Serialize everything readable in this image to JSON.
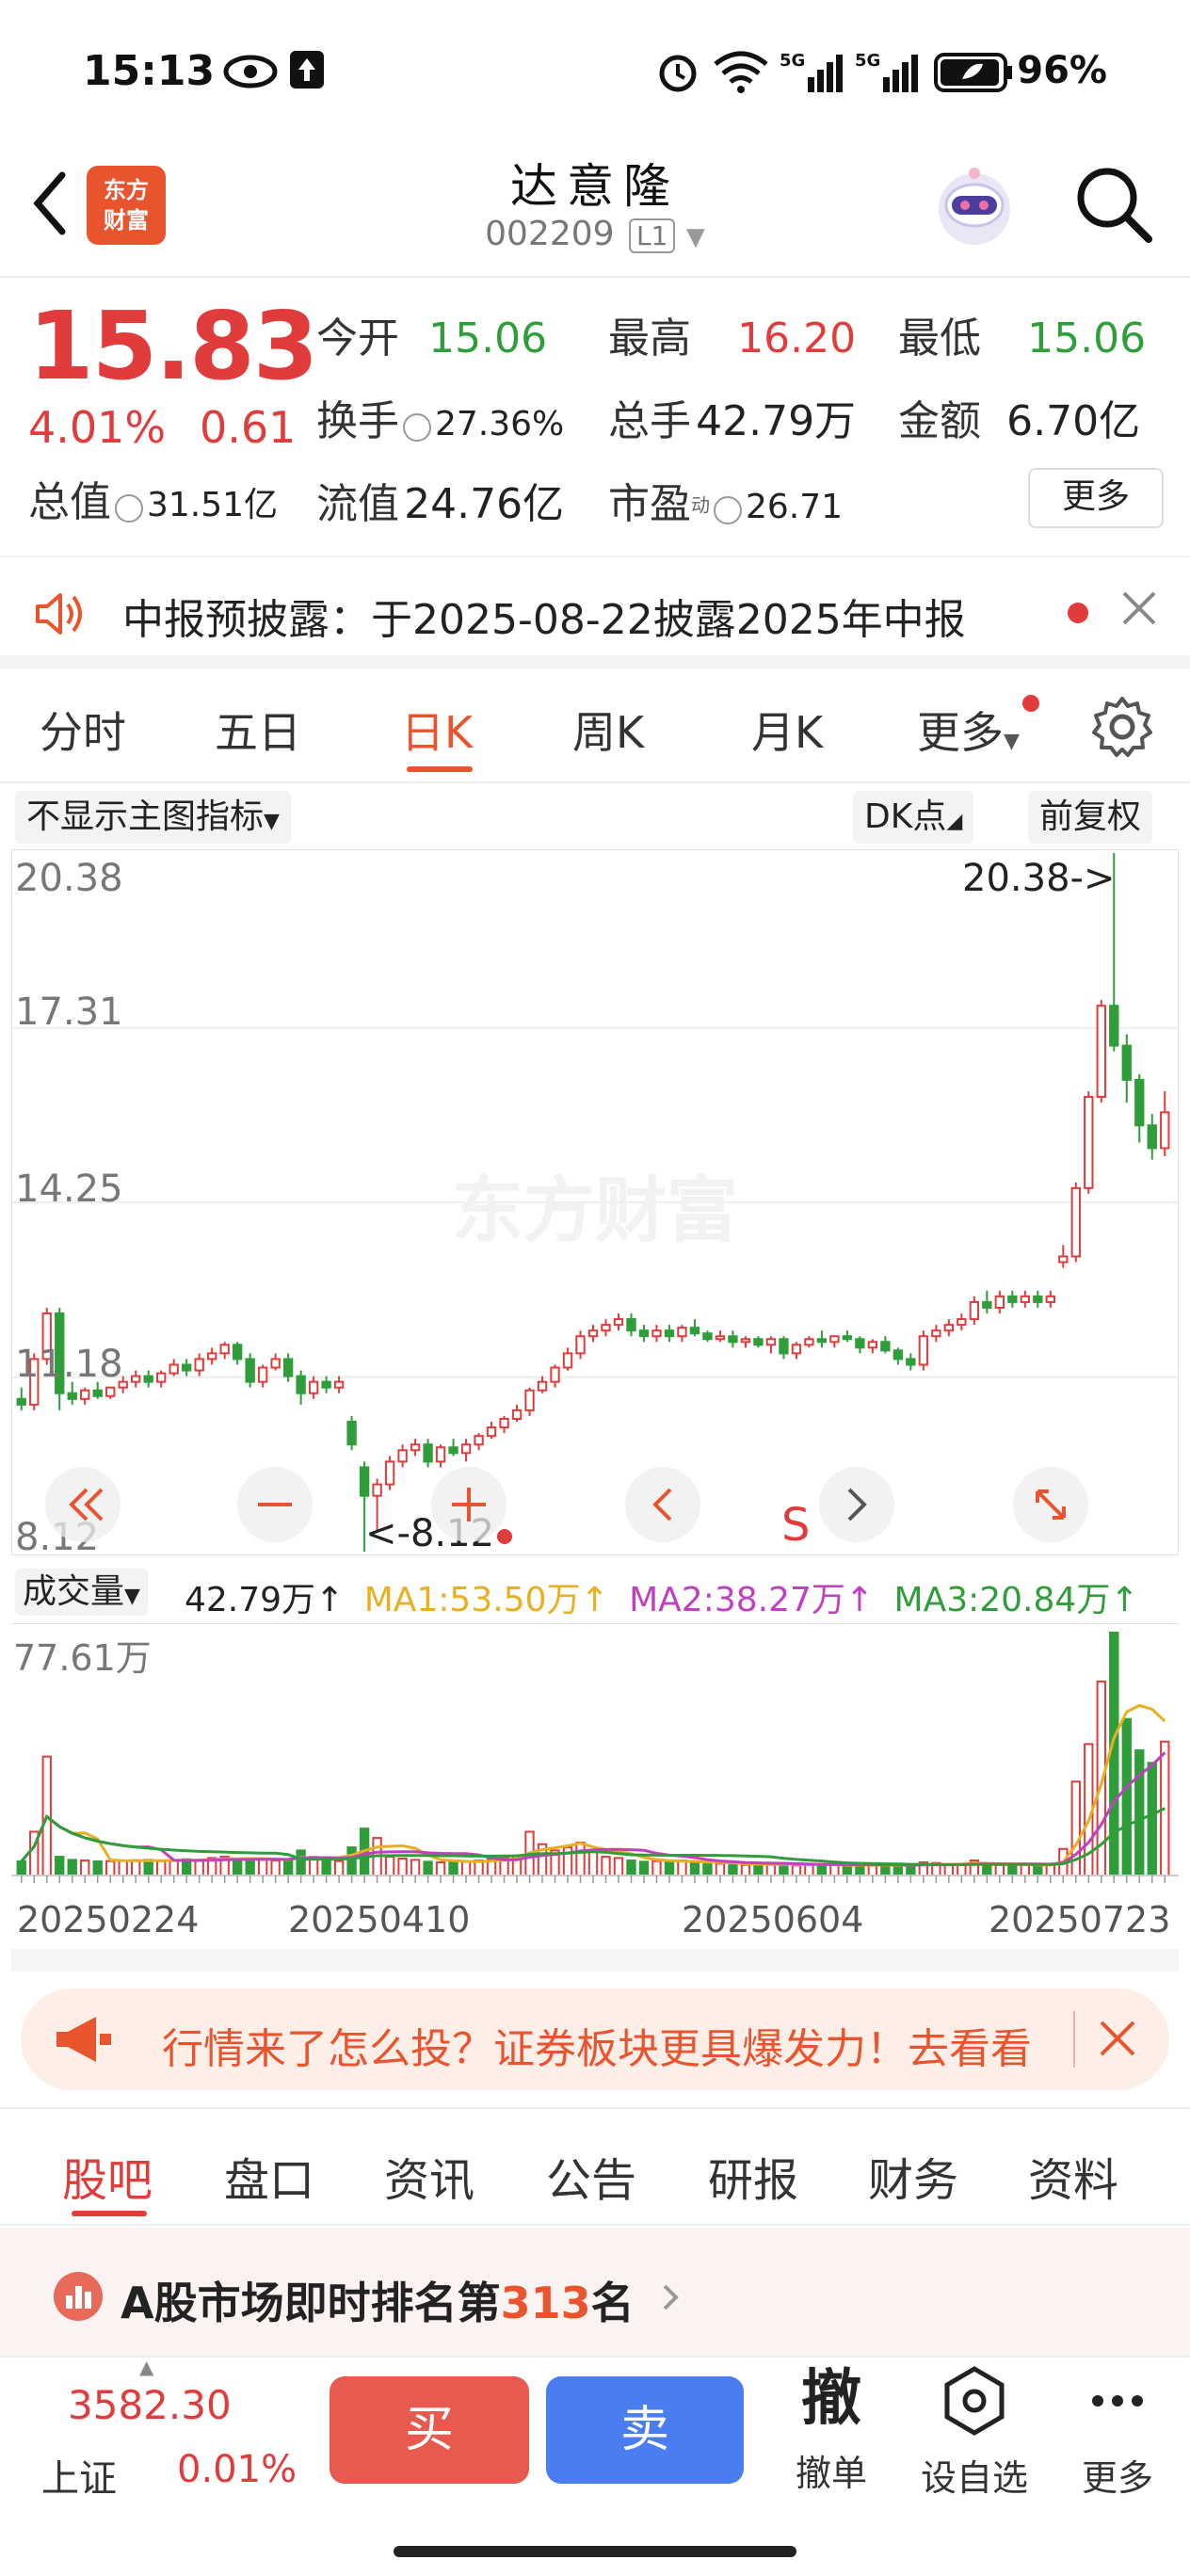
{
  "status_bar": {
    "time": "15:13",
    "battery": "96%",
    "icons": [
      "eye-icon",
      "upload-icon",
      "alarm-icon",
      "wifi-icon",
      "signal-5g-icon",
      "signal-5g-icon",
      "battery-icon"
    ]
  },
  "header": {
    "logo_line1": "东方",
    "logo_line2": "财富",
    "stock_name": "达意隆",
    "stock_code": "002209",
    "level_tag": "L1"
  },
  "quote": {
    "price": "15.83",
    "change_pct": "4.01%",
    "change_amt": "0.61",
    "fields": {
      "open_label": "今开",
      "open_value": "15.06",
      "high_label": "最高",
      "high_value": "16.20",
      "low_label": "最低",
      "low_value": "15.06",
      "turnover_label": "换手",
      "turnover_value": "27.36%",
      "volume_label": "总手",
      "volume_value": "42.79万",
      "amount_label": "金额",
      "amount_value": "6.70亿",
      "mktcap_label": "总值",
      "mktcap_value": "31.51亿",
      "float_label": "流值",
      "float_value": "24.76亿",
      "pe_label": "市盈",
      "pe_sup": "动",
      "pe_value": "26.71"
    },
    "more_label": "更多"
  },
  "notice": {
    "text": "中报预披露：于2025-08-22披露2025年中报"
  },
  "chart_tabs": {
    "items": [
      "分时",
      "五日",
      "日K",
      "周K",
      "月K",
      "更多"
    ],
    "active_index": 2
  },
  "chart_toolbar": {
    "indicator_select": "不显示主图指标",
    "dk_select": "DK点",
    "adjust_select": "前复权"
  },
  "kline": {
    "y_labels": [
      "20.38",
      "17.31",
      "14.25",
      "11.18",
      "8.12"
    ],
    "max_annotation": "20.38->",
    "min_annotation": "<-8.12",
    "signal_label": "S",
    "watermark": "东方财富",
    "controls": [
      "double-left-icon",
      "zoom-out-icon",
      "zoom-in-icon",
      "chevron-left-icon",
      "chevron-right-icon",
      "expand-icon"
    ]
  },
  "volume": {
    "select_label": "成交量",
    "current": "42.79万",
    "ma1": "MA1:53.50万",
    "ma2": "MA2:38.27万",
    "ma3": "MA3:20.84万",
    "y_max_label": "77.61万",
    "x_labels": [
      "20250224",
      "20250410",
      "20250604",
      "20250723"
    ]
  },
  "promo": {
    "text": "行情来了怎么投？证券板块更具爆发力！去看看"
  },
  "bottom_tabs": {
    "items": [
      "股吧",
      "盘口",
      "资讯",
      "公告",
      "研报",
      "财务",
      "资料"
    ],
    "active_index": 0
  },
  "rank": {
    "prefix": "A股市场即时排名第",
    "number": "313",
    "suffix": "名"
  },
  "bottom_bar": {
    "index_value": "3582.30",
    "index_name": "上证",
    "index_pct": "0.01%",
    "buy_label": "买",
    "sell_label": "卖",
    "cancel_icon_char": "撤",
    "cancel_label": "撤单",
    "watchlist_label": "设自选",
    "more_label": "更多"
  },
  "colors": {
    "up": "#e03c3c",
    "down": "#2f9e3a",
    "accent": "#e8542e",
    "sell_blue": "#4a7ef0",
    "ma1": "#e8b020",
    "ma2": "#c040c0",
    "ma3": "#2f9e3a"
  },
  "chart_data": {
    "type": "candlestick",
    "ylim": [
      8.12,
      20.38
    ],
    "x_labels": [
      "20250224",
      "20250410",
      "20250604",
      "20250723"
    ],
    "candles": [
      [
        10.8,
        11.0,
        10.6,
        10.7
      ],
      [
        10.7,
        11.6,
        10.6,
        11.5
      ],
      [
        11.5,
        12.4,
        11.4,
        12.3
      ],
      [
        12.3,
        12.4,
        10.6,
        10.9
      ],
      [
        10.9,
        11.1,
        10.7,
        10.8
      ],
      [
        10.8,
        11.0,
        10.7,
        10.95
      ],
      [
        10.95,
        11.1,
        10.8,
        10.85
      ],
      [
        10.85,
        11.0,
        10.8,
        11.0
      ],
      [
        11.0,
        11.2,
        10.9,
        11.1
      ],
      [
        11.1,
        11.3,
        11.0,
        11.2
      ],
      [
        11.2,
        11.3,
        11.0,
        11.1
      ],
      [
        11.1,
        11.3,
        11.0,
        11.25
      ],
      [
        11.25,
        11.5,
        11.2,
        11.4
      ],
      [
        11.4,
        11.5,
        11.2,
        11.3
      ],
      [
        11.3,
        11.6,
        11.2,
        11.5
      ],
      [
        11.5,
        11.7,
        11.4,
        11.6
      ],
      [
        11.6,
        11.8,
        11.5,
        11.75
      ],
      [
        11.75,
        11.8,
        11.4,
        11.5
      ],
      [
        11.5,
        11.6,
        11.0,
        11.1
      ],
      [
        11.1,
        11.4,
        11.0,
        11.35
      ],
      [
        11.35,
        11.6,
        11.3,
        11.5
      ],
      [
        11.5,
        11.6,
        11.1,
        11.2
      ],
      [
        11.2,
        11.3,
        10.7,
        10.9
      ],
      [
        10.9,
        11.2,
        10.8,
        11.1
      ],
      [
        11.1,
        11.2,
        10.9,
        11.0
      ],
      [
        11.0,
        11.2,
        10.9,
        11.1
      ],
      [
        10.4,
        10.5,
        9.9,
        10.0
      ],
      [
        9.6,
        9.7,
        8.12,
        9.1
      ],
      [
        9.1,
        9.4,
        8.5,
        9.3
      ],
      [
        9.3,
        9.8,
        9.2,
        9.7
      ],
      [
        9.7,
        10.0,
        9.6,
        9.9
      ],
      [
        9.9,
        10.1,
        9.8,
        10.0
      ],
      [
        10.0,
        10.1,
        9.6,
        9.7
      ],
      [
        9.7,
        10.0,
        9.6,
        9.95
      ],
      [
        9.95,
        10.1,
        9.8,
        9.85
      ],
      [
        9.85,
        10.1,
        9.7,
        10.0
      ],
      [
        10.0,
        10.2,
        9.9,
        10.15
      ],
      [
        10.15,
        10.4,
        10.1,
        10.3
      ],
      [
        10.3,
        10.5,
        10.2,
        10.45
      ],
      [
        10.45,
        10.7,
        10.4,
        10.6
      ],
      [
        10.6,
        11.0,
        10.5,
        10.95
      ],
      [
        10.95,
        11.2,
        10.9,
        11.1
      ],
      [
        11.1,
        11.4,
        11.0,
        11.35
      ],
      [
        11.35,
        11.7,
        11.3,
        11.6
      ],
      [
        11.6,
        12.0,
        11.5,
        11.9
      ],
      [
        11.9,
        12.1,
        11.8,
        12.0
      ],
      [
        12.0,
        12.2,
        11.9,
        12.1
      ],
      [
        12.1,
        12.3,
        12.0,
        12.2
      ],
      [
        12.2,
        12.3,
        11.9,
        12.0
      ],
      [
        12.0,
        12.1,
        11.8,
        11.9
      ],
      [
        11.9,
        12.1,
        11.8,
        12.0
      ],
      [
        12.0,
        12.1,
        11.8,
        11.9
      ],
      [
        11.9,
        12.1,
        11.8,
        12.05
      ],
      [
        12.05,
        12.2,
        11.9,
        11.95
      ],
      [
        11.95,
        12.0,
        11.8,
        11.85
      ],
      [
        11.85,
        12.0,
        11.8,
        11.9
      ],
      [
        11.9,
        12.0,
        11.7,
        11.8
      ],
      [
        11.8,
        11.9,
        11.7,
        11.85
      ],
      [
        11.85,
        11.9,
        11.7,
        11.75
      ],
      [
        11.75,
        11.9,
        11.6,
        11.85
      ],
      [
        11.85,
        11.9,
        11.5,
        11.6
      ],
      [
        11.6,
        11.8,
        11.5,
        11.75
      ],
      [
        11.75,
        11.9,
        11.7,
        11.85
      ],
      [
        11.85,
        12.0,
        11.7,
        11.8
      ],
      [
        11.8,
        11.9,
        11.7,
        11.9
      ],
      [
        11.9,
        12.0,
        11.8,
        11.85
      ],
      [
        11.85,
        11.9,
        11.6,
        11.7
      ],
      [
        11.7,
        11.85,
        11.6,
        11.8
      ],
      [
        11.8,
        11.9,
        11.6,
        11.65
      ],
      [
        11.65,
        11.7,
        11.4,
        11.5
      ],
      [
        11.5,
        11.6,
        11.3,
        11.4
      ],
      [
        11.4,
        12.0,
        11.3,
        11.9
      ],
      [
        11.9,
        12.1,
        11.8,
        12.0
      ],
      [
        12.0,
        12.2,
        11.9,
        12.1
      ],
      [
        12.1,
        12.3,
        12.0,
        12.2
      ],
      [
        12.2,
        12.6,
        12.1,
        12.5
      ],
      [
        12.5,
        12.7,
        12.3,
        12.4
      ],
      [
        12.4,
        12.7,
        12.3,
        12.6
      ],
      [
        12.6,
        12.7,
        12.4,
        12.5
      ],
      [
        12.5,
        12.7,
        12.4,
        12.6
      ],
      [
        12.6,
        12.7,
        12.4,
        12.5
      ],
      [
        12.5,
        12.7,
        12.4,
        12.6
      ],
      [
        13.2,
        13.5,
        13.1,
        13.3
      ],
      [
        13.3,
        14.6,
        13.2,
        14.5
      ],
      [
        14.5,
        16.2,
        14.4,
        16.1
      ],
      [
        16.1,
        17.8,
        16.0,
        17.7
      ],
      [
        17.7,
        20.38,
        16.9,
        17.0
      ],
      [
        17.0,
        17.2,
        16.0,
        16.4
      ],
      [
        16.4,
        16.5,
        15.3,
        15.6
      ],
      [
        15.6,
        15.8,
        15.0,
        15.2
      ],
      [
        15.2,
        16.2,
        15.06,
        15.83
      ]
    ],
    "volume_ylim": [
      0,
      77.61
    ],
    "volume": [
      4.5,
      14.0,
      38.0,
      6.0,
      5.0,
      4.8,
      4.5,
      4.6,
      4.7,
      4.9,
      5.0,
      4.6,
      4.8,
      5.2,
      5.0,
      5.6,
      6.0,
      5.0,
      5.4,
      5.0,
      4.8,
      5.2,
      8.0,
      6.0,
      5.0,
      4.6,
      9.0,
      15.0,
      12.0,
      6.0,
      5.4,
      5.0,
      4.4,
      4.2,
      4.6,
      4.4,
      4.8,
      5.2,
      5.8,
      6.4,
      14.0,
      10.0,
      8.0,
      9.0,
      10.5,
      8.0,
      6.0,
      5.6,
      4.8,
      4.4,
      4.6,
      4.2,
      4.8,
      4.4,
      3.6,
      3.8,
      3.6,
      3.4,
      3.6,
      3.4,
      4.0,
      3.2,
      3.4,
      3.6,
      3.4,
      3.0,
      3.2,
      3.4,
      3.6,
      3.2,
      3.0,
      4.2,
      4.0,
      3.4,
      3.6,
      4.8,
      3.8,
      3.4,
      3.0,
      3.4,
      3.2,
      3.6,
      8.5,
      30.0,
      42.0,
      62.0,
      77.61,
      50.0,
      40.0,
      36.0,
      42.79
    ]
  }
}
